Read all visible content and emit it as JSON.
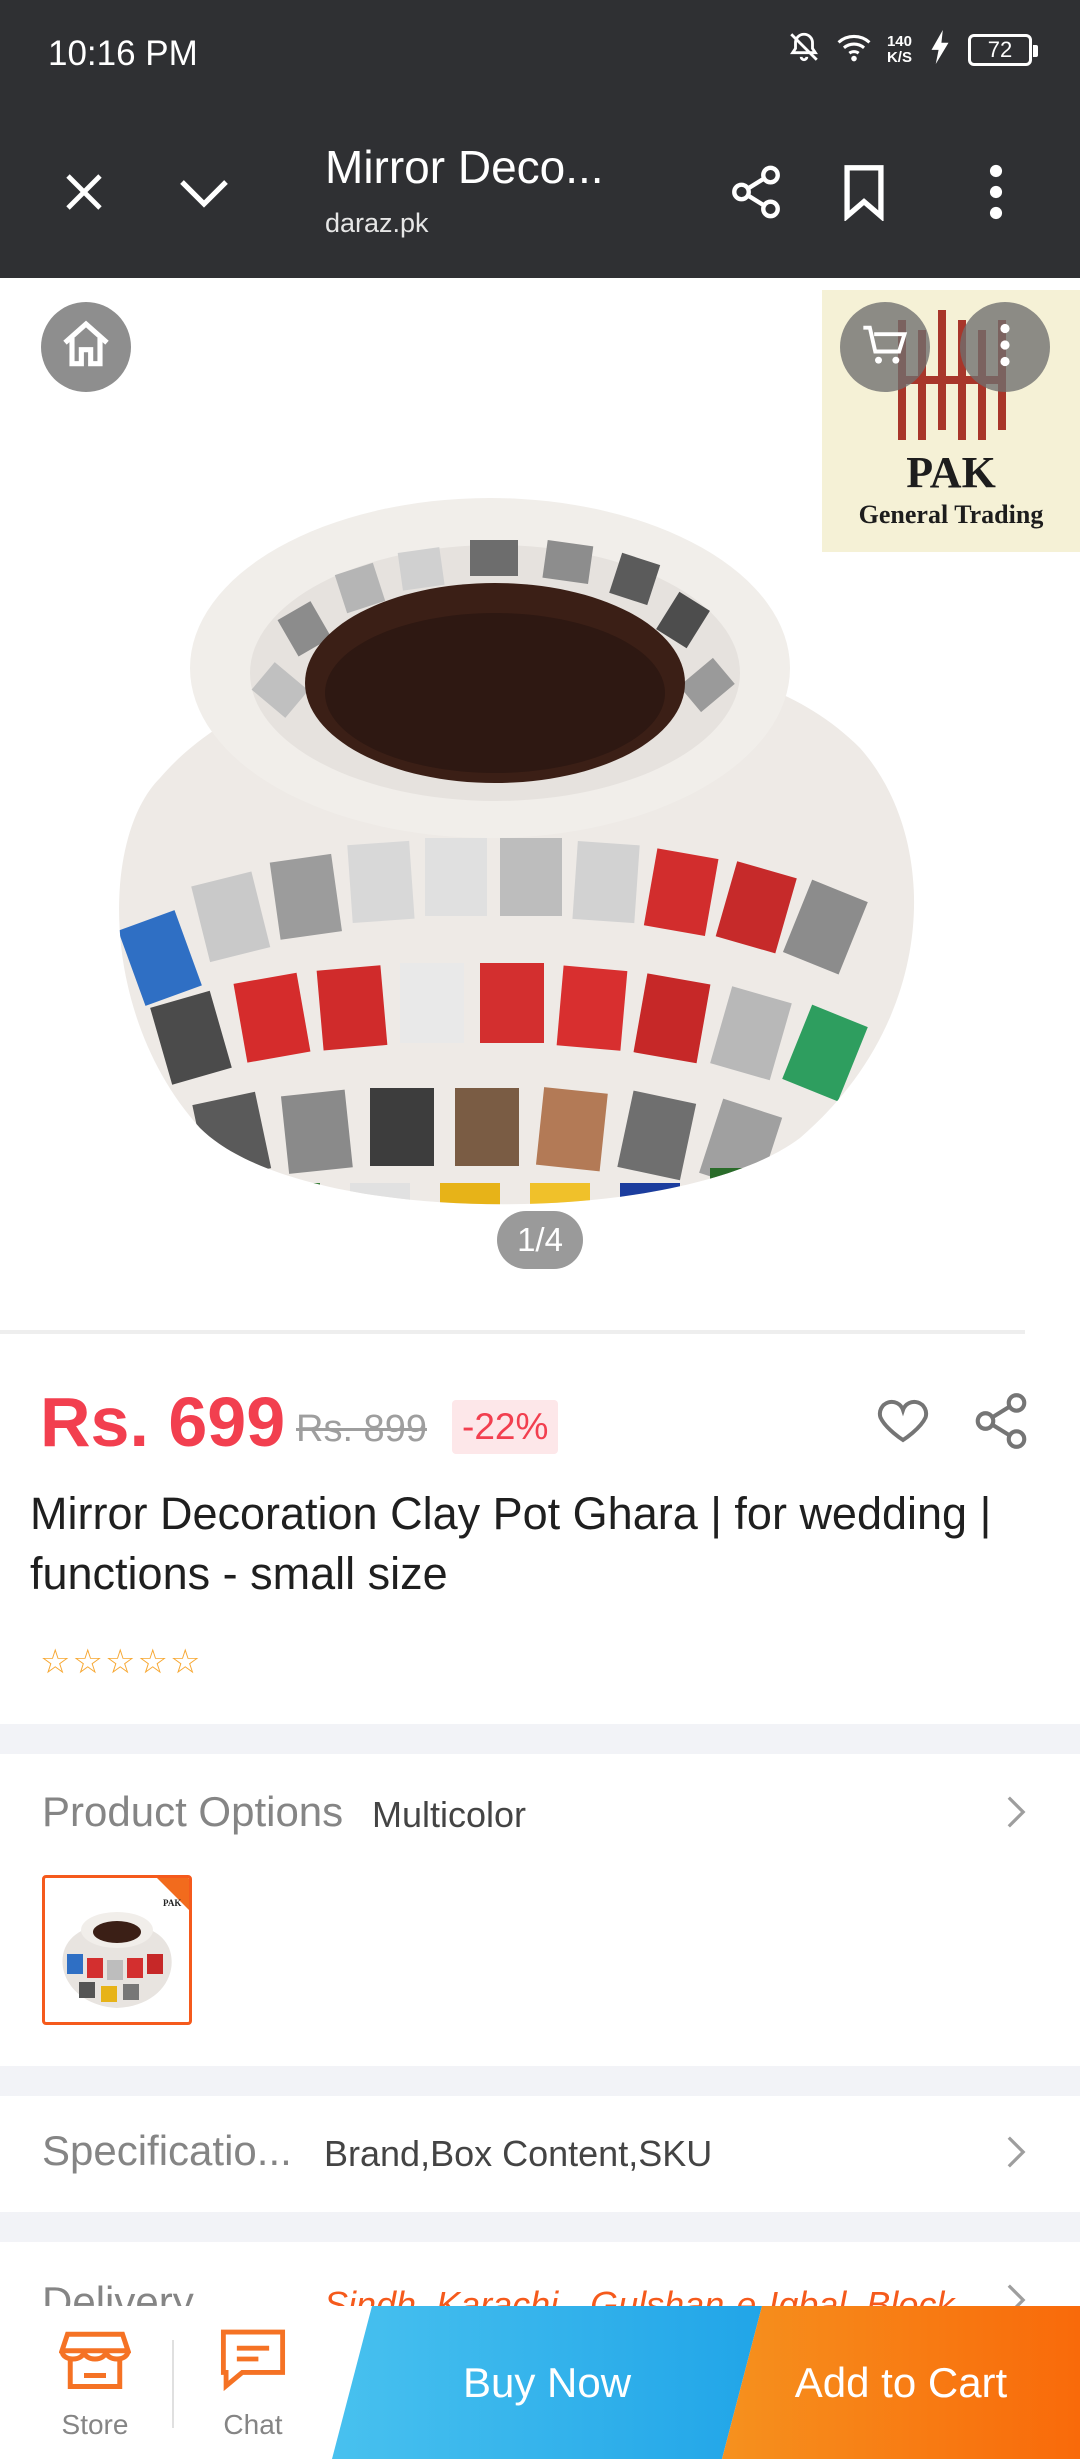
{
  "status_bar": {
    "time": "10:16 PM",
    "net_speed_value": "140",
    "net_speed_unit": "K/S",
    "battery": "72",
    "icons": [
      "bell-muted-icon",
      "wifi-icon",
      "charging-icon",
      "battery-icon"
    ]
  },
  "toolbar": {
    "title": "Mirror Deco...",
    "url": "daraz.pk",
    "icons": [
      "close-icon",
      "chevron-down-icon",
      "share-icon",
      "bookmark-icon",
      "more-vert-icon"
    ]
  },
  "gallery": {
    "logo_name": "PAK",
    "logo_subtitle": "General Trading",
    "counter": "1/4",
    "icons": [
      "home-icon",
      "cart-icon",
      "more-vert-icon"
    ]
  },
  "product": {
    "price": "Rs. 699",
    "old_price": "Rs. 899",
    "discount": "-22%",
    "title": "Mirror Decoration Clay Pot Ghara | for wedding | functions - small size",
    "rating_stars": 0,
    "accent_color": "#f23f4f"
  },
  "options": {
    "label": "Product Options",
    "value": "Multicolor",
    "thumb_logo": "PAK"
  },
  "specification": {
    "label": "Specificatio...",
    "value": "Brand,Box Content,SKU"
  },
  "delivery": {
    "label": "Delivery",
    "value": "Sindh, Karachi - Gulshan-e-Iqbal, Block"
  },
  "bottom_bar": {
    "store_label": "Store",
    "chat_label": "Chat",
    "buy_now_label": "Buy Now",
    "add_to_cart_label": "Add to Cart",
    "buy_now_color": "#21a5e8",
    "add_to_cart_color": "#f96a0a"
  }
}
